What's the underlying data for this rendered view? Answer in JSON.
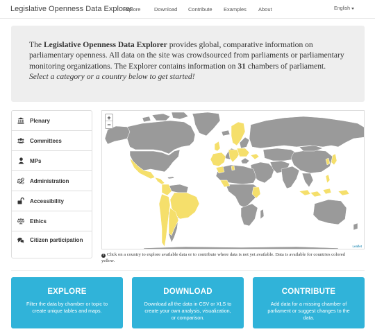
{
  "navbar": {
    "brand": "Legislative Openness Data Explorer",
    "links": [
      "Explore",
      "Download",
      "Contribute",
      "Examples",
      "About"
    ],
    "language": "English"
  },
  "intro": {
    "title_bold": "Legislative Openness Data Explorer",
    "text_1": "The ",
    "text_2": " provides global, comparative information on parliamentary openness. All data on the site was crowdsourced from parliaments or parliamentary monitoring organizations. The Explorer contains information on ",
    "count": "31",
    "text_3": " chambers of parliament. ",
    "cta_italic": "Select a category or a country below to get started!"
  },
  "sidebar": {
    "items": [
      {
        "label": "Plenary",
        "icon": "bank-icon"
      },
      {
        "label": "Committees",
        "icon": "users-icon"
      },
      {
        "label": "MPs",
        "icon": "user-icon"
      },
      {
        "label": "Administration",
        "icon": "cogs-icon"
      },
      {
        "label": "Accessibility",
        "icon": "unlock-icon"
      },
      {
        "label": "Ethics",
        "icon": "balance-scale-icon"
      },
      {
        "label": "Citizen participation",
        "icon": "comments-icon"
      }
    ]
  },
  "map": {
    "zoom_in": "+",
    "zoom_out": "−",
    "attribution": "Leaflet",
    "note": "Click on a country to explore available data or to contribute where data is not yet available. Data is available for countries colored yellow.",
    "colors": {
      "available": "#f5df6b",
      "unavailable": "#9a9a9a",
      "ocean": "#ffffff"
    }
  },
  "cta": [
    {
      "title": "EXPLORE",
      "text": "Filter the data by chamber or topic to create unique tables and maps."
    },
    {
      "title": "DOWNLOAD",
      "text": "Download all the data in CSV or XLS to create your own analysis, visualization, or comparison."
    },
    {
      "title": "CONTRIBUTE",
      "text": "Add data for a missing chamber of parliament or suggest changes to the data."
    }
  ],
  "colors": {
    "accent": "#30b3d9",
    "jumbotron": "#eeeeee"
  }
}
